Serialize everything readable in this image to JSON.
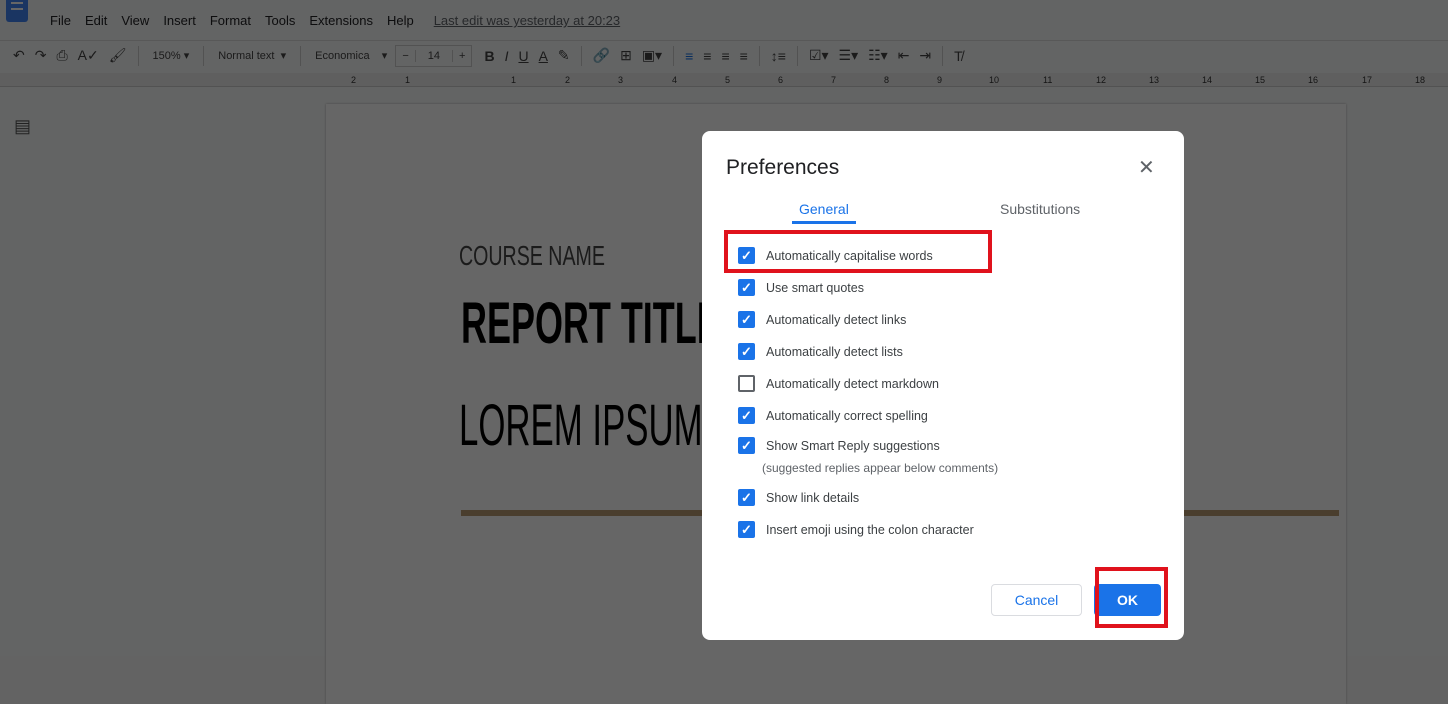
{
  "menu": {
    "items": [
      "File",
      "Edit",
      "View",
      "Insert",
      "Format",
      "Tools",
      "Extensions",
      "Help"
    ],
    "last_edit": "Last edit was yesterday at 20:23"
  },
  "toolbar": {
    "zoom": "150%",
    "style": "Normal text",
    "font": "Economica",
    "font_size": "14",
    "minus": "−",
    "plus": "+"
  },
  "ruler": {
    "ticks": [
      "2",
      "1",
      "1",
      "2",
      "3",
      "4",
      "5",
      "6",
      "7",
      "8",
      "9",
      "10",
      "11",
      "12",
      "13",
      "14",
      "15",
      "16",
      "17",
      "18"
    ]
  },
  "document": {
    "course": "COURSE NAME",
    "title": "REPORT TITLE",
    "subtitle": "LOREM IPSUM",
    "rule_color": "#b89a74"
  },
  "dialog": {
    "title": "Preferences",
    "tabs": [
      "General",
      "Substitutions"
    ],
    "options": [
      {
        "label": "Automatically capitalise words",
        "checked": true
      },
      {
        "label": "Use smart quotes",
        "checked": true
      },
      {
        "label": "Automatically detect links",
        "checked": true
      },
      {
        "label": "Automatically detect lists",
        "checked": true
      },
      {
        "label": "Automatically detect markdown",
        "checked": false
      },
      {
        "label": "Automatically correct spelling",
        "checked": true
      },
      {
        "label": "Show Smart Reply suggestions",
        "checked": true
      },
      {
        "label": "Show link details",
        "checked": true
      },
      {
        "label": "Insert emoji using the colon character",
        "checked": true
      }
    ],
    "smart_reply_note": "(suggested replies appear below comments)",
    "cancel": "Cancel",
    "ok": "OK"
  },
  "colors": {
    "accent": "#1a73e8",
    "highlight": "#e0121c"
  }
}
